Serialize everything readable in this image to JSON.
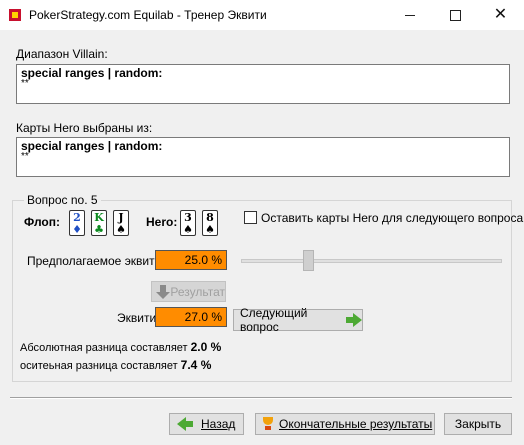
{
  "window": {
    "title": "PokerStrategy.com Equilab - Тренер Эквити",
    "minimize": "—",
    "close": "✕"
  },
  "villain": {
    "label": "Диапазон Villain:",
    "range": "special ranges | random:",
    "sub": "**"
  },
  "hero_cards": {
    "label": "Карты Hero выбраны из:",
    "range": "special ranges | random:",
    "sub": "**"
  },
  "question": {
    "legend": "Вопрос no. 5",
    "flop_label": "Флоп:",
    "flop": [
      {
        "rank": "2",
        "suit": "♦",
        "color": "#1f4fc4"
      },
      {
        "rank": "K",
        "suit": "♣",
        "color": "#0b8a1f"
      },
      {
        "rank": "J",
        "suit": "♠",
        "color": "#000000"
      }
    ],
    "hero_label": "Hero:",
    "hero": [
      {
        "rank": "3",
        "suit": "♠",
        "color": "#000000"
      },
      {
        "rank": "8",
        "suit": "♠",
        "color": "#000000"
      }
    ],
    "keep_cards_label": "Оставить карты Hero для следующего вопроса",
    "keep_cards_checked": false,
    "estimate_label": "Предполагаемое эквити:",
    "estimate_value": "25.0 %",
    "slider_fraction": 0.25,
    "result_button": "Результат",
    "equity_label": "Эквити:",
    "equity_value": "27.0 %",
    "next_button": "Следующий вопрос",
    "abs_diff_label": "Абсолютная разница составляет",
    "abs_diff_value": "2.0 %",
    "rel_diff_label": "оситеьная разница составляет",
    "rel_diff_value": "7.4 %"
  },
  "footer": {
    "back_button": "Назад",
    "final_button": "Окончательные результаты",
    "close_button": "Закрыть"
  },
  "colors": {
    "equity_field": "#ff8c00",
    "arrow_green": "#4da934"
  }
}
